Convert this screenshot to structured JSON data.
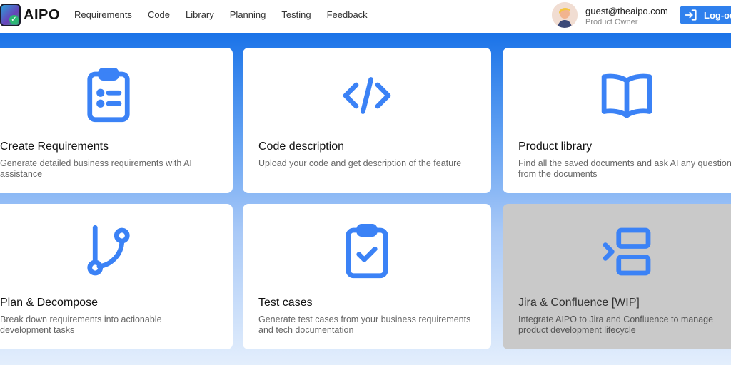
{
  "brand": {
    "name": "AIPO"
  },
  "nav": {
    "items": [
      "Requirements",
      "Code",
      "Library",
      "Planning",
      "Testing",
      "Feedback"
    ]
  },
  "user": {
    "email": "guest@theaipo.com",
    "role": "Product Owner"
  },
  "logout_label": "Log-out",
  "colors": {
    "accent": "#2f80ed",
    "icon": "#3b82f6"
  },
  "cards": [
    {
      "title": "Create Requirements",
      "description": "Generate detailed business requirements with AI assistance",
      "icon": "clipboard-list-icon"
    },
    {
      "title": "Code description",
      "description": "Upload your code and get description of the feature",
      "icon": "code-icon"
    },
    {
      "title": "Product library",
      "description": "Find all the saved documents and ask AI any question from the documents",
      "icon": "book-icon"
    },
    {
      "title": "Plan & Decompose",
      "description": "Break down requirements into actionable development tasks",
      "icon": "branch-icon"
    },
    {
      "title": "Test cases",
      "description": "Generate test cases from your business requirements and tech documentation",
      "icon": "clipboard-check-icon"
    },
    {
      "title": "Jira & Confluence [WIP]",
      "description": "Integrate AIPO to Jira and Confluence to manage product development lifecycle",
      "icon": "integration-icon"
    }
  ]
}
